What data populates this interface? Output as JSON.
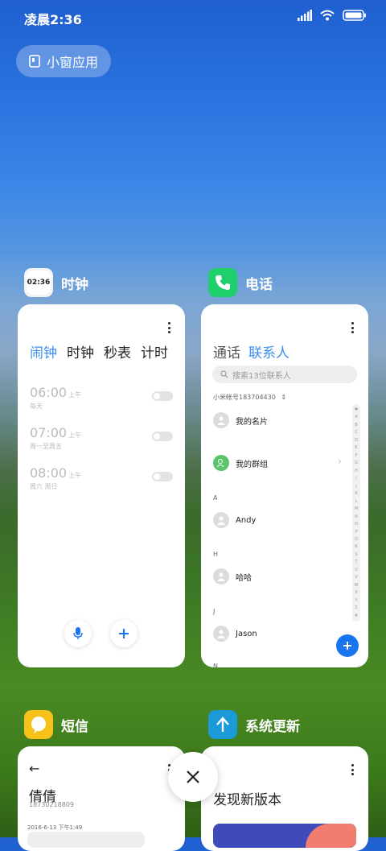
{
  "status_bar": {
    "time": "凌晨2:36"
  },
  "pill": {
    "label": "小窗应用"
  },
  "clock_app": {
    "name": "时钟",
    "icon_time": "02:36",
    "tabs": [
      "闹钟",
      "时钟",
      "秒表",
      "计时"
    ],
    "alarms": [
      {
        "time": "06:00",
        "ampm": "上午",
        "days": "每天"
      },
      {
        "time": "07:00",
        "ampm": "上午",
        "days": "周一至周五"
      },
      {
        "time": "08:00",
        "ampm": "上午",
        "days": "周六 周日"
      }
    ]
  },
  "phone_app": {
    "name": "电话",
    "tabs": [
      "通话",
      "联系人"
    ],
    "search_placeholder": "搜索13位联系人",
    "account": "小米帐号183704430",
    "contacts": {
      "my_card": "我的名片",
      "my_group": "我的群组",
      "letter_a": "A",
      "andy": "Andy",
      "letter_h": "H",
      "haha": "哈哈",
      "letter_j": "J",
      "jason": "Jason",
      "letter_n": "N"
    },
    "alphabet": [
      "♥",
      "A",
      "B",
      "C",
      "D",
      "E",
      "F",
      "G",
      "H",
      "I",
      "J",
      "K",
      "L",
      "M",
      "N",
      "O",
      "P",
      "Q",
      "R",
      "S",
      "T",
      "U",
      "V",
      "W",
      "X",
      "Y",
      "Z",
      "#"
    ]
  },
  "sms_app": {
    "name": "短信",
    "contact_name": "倩倩",
    "contact_number": "18730218809",
    "timestamp": "2016-6-13 下午1:49"
  },
  "update_app": {
    "name": "系统更新",
    "headline": "发现新版本"
  }
}
